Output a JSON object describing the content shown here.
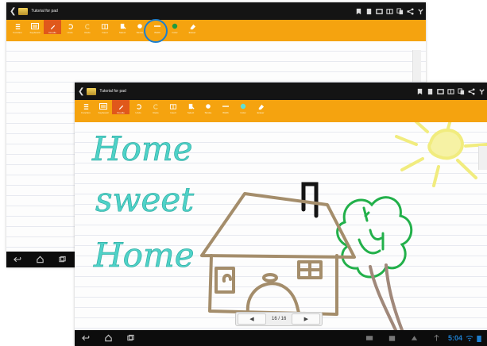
{
  "app": {
    "title": "Tutorial for pad"
  },
  "titlebar_icons": [
    "bookmark-icon",
    "page-icon",
    "export-icon",
    "layout-icon",
    "copy-icon",
    "share-icon",
    "menu-icon"
  ],
  "toolbar": {
    "tools": [
      {
        "name": "tool-function",
        "label": "Function"
      },
      {
        "name": "tool-keyboard",
        "label": "Keyboard"
      },
      {
        "name": "tool-doodle",
        "label": "Doodle"
      },
      {
        "name": "tool-undo",
        "label": "Undo"
      },
      {
        "name": "tool-redo",
        "label": "Redo"
      },
      {
        "name": "tool-insert",
        "label": "Insert"
      },
      {
        "name": "tool-select",
        "label": "Select"
      },
      {
        "name": "tool-stroke",
        "label": "Stroke"
      },
      {
        "name": "tool-width",
        "label": "Width"
      },
      {
        "name": "tool-color",
        "label": "Color"
      },
      {
        "name": "tool-eraser",
        "label": "Eraser"
      }
    ]
  },
  "canvas": {
    "handwriting": [
      "Home",
      "sweet",
      "Home"
    ],
    "ink_colors": {
      "text": "#4fd2c8",
      "house": "#a48d6b",
      "chimney": "#151515",
      "tree": "#22b04a",
      "trunk": "#a0887a",
      "sun": "#f1ec7e"
    }
  },
  "pager": {
    "prev": "◀",
    "next": "▶",
    "page_info": "16 / 16"
  },
  "status": {
    "time": "5:04"
  },
  "colors": {
    "toolbar": "#f5a30f",
    "active_tool": "#e0581b",
    "highlight": "#1b7fd0",
    "titlebar": "#141414"
  }
}
